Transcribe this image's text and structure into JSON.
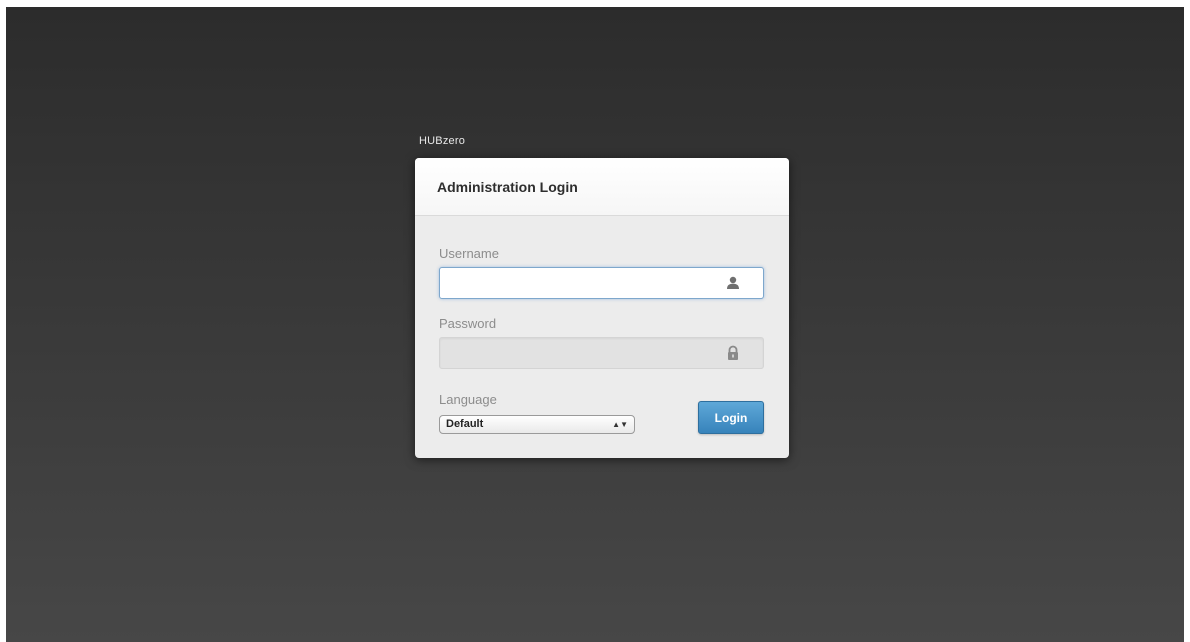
{
  "brand": {
    "name": "HUBzero"
  },
  "login": {
    "title": "Administration Login",
    "username_label": "Username",
    "username_value": "",
    "password_label": "Password",
    "password_value": "",
    "language_label": "Language",
    "language_selected": "Default",
    "submit_label": "Login"
  },
  "icons": {
    "username": "user-icon",
    "password": "lock-icon",
    "select": "select-arrows-icon"
  },
  "colors": {
    "background_top": "#2c2c2c",
    "background_bottom": "#474747",
    "panel": "#ececec",
    "focus_border": "#7ea7cc",
    "button": "#3783bb"
  }
}
